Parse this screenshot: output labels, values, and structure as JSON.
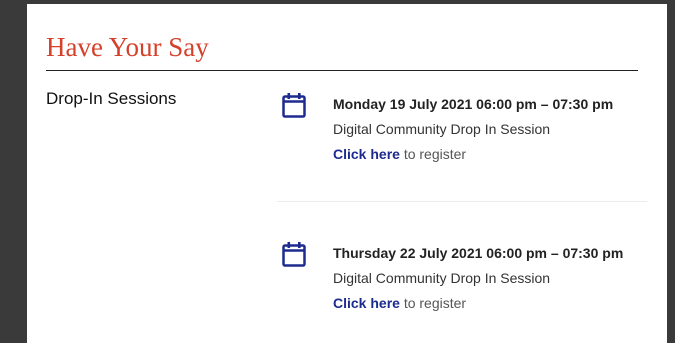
{
  "page": {
    "heading": "Have Your Say",
    "section_label": "Drop-In Sessions"
  },
  "events": [
    {
      "date": "Monday 19 July 2021 06:00 pm – 07:30 pm",
      "title": "Digital Community Drop In Session",
      "link_label": "Click here",
      "link_suffix": " to register",
      "icon": "calendar-icon"
    },
    {
      "date": "Thursday 22 July 2021 06:00 pm – 07:30 pm",
      "title": "Digital Community Drop In Session",
      "link_label": "Click here",
      "link_suffix": " to register",
      "icon": "calendar-icon"
    }
  ],
  "colors": {
    "heading": "#d5402b",
    "link": "#1d2a8e",
    "icon": "#1d2a8e",
    "backdrop": "#3a3a3a"
  }
}
